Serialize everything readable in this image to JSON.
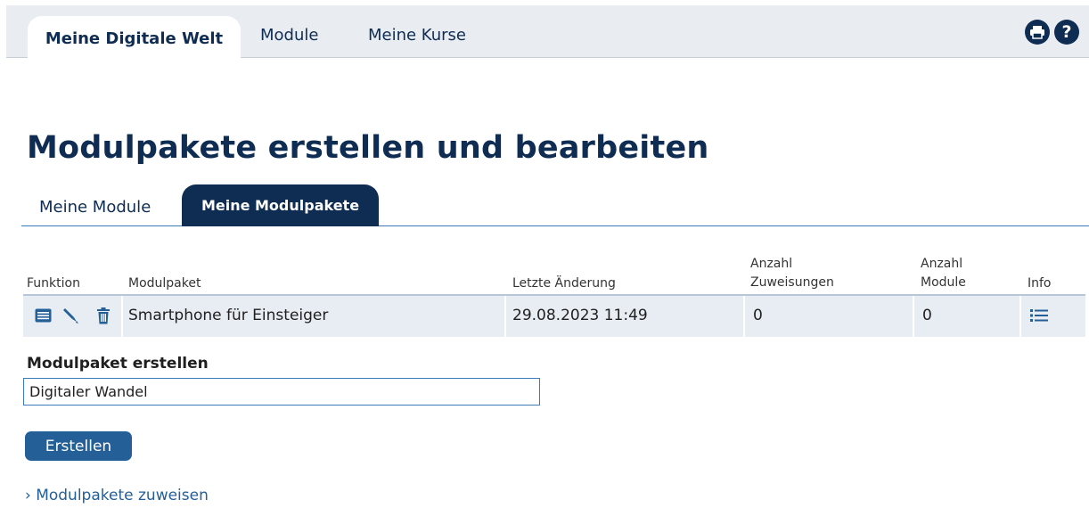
{
  "top_nav": {
    "tabs": [
      {
        "label": "Meine Digitale Welt",
        "active": true
      },
      {
        "label": "Module",
        "active": false
      },
      {
        "label": "Meine Kurse",
        "active": false
      }
    ],
    "icons": [
      "print-icon",
      "help-icon"
    ]
  },
  "page_title": "Modulpakete erstellen und bearbeiten",
  "sub_tabs": [
    {
      "label": "Meine Module",
      "active": false
    },
    {
      "label": "Meine Modulpakete",
      "active": true
    }
  ],
  "table": {
    "headers": {
      "funktion": "Funktion",
      "modulpaket": "Modulpaket",
      "letzte_aenderung": "Letzte Änderung",
      "anzahl_zuweisungen_1": "Anzahl",
      "anzahl_zuweisungen_2": "Zuweisungen",
      "anzahl_module_1": "Anzahl",
      "anzahl_module_2": "Module",
      "info": "Info"
    },
    "rows": [
      {
        "modulpaket": "Smartphone für Einsteiger",
        "letzte_aenderung": "29.08.2023 11:49",
        "anzahl_zuweisungen": "0",
        "anzahl_module": "0",
        "actions": [
          "view-icon",
          "edit-icon",
          "delete-icon"
        ],
        "info_icon": "list-icon"
      }
    ]
  },
  "create_form": {
    "label": "Modulpaket erstellen",
    "value": "Digitaler Wandel",
    "button_label": "Erstellen"
  },
  "assign_link": "› Modulpakete zuweisen",
  "colors": {
    "navy": "#0f2c52",
    "accent_blue": "#245f97",
    "row_bg": "#e8edf3",
    "topbar_bg": "#e9edf2"
  }
}
